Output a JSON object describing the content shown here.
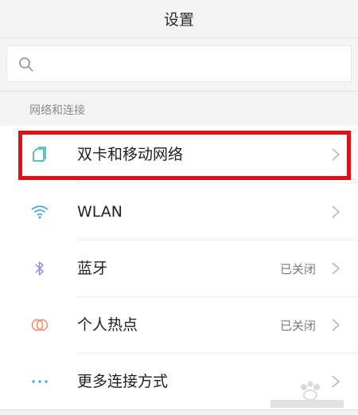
{
  "header": {
    "title": "设置"
  },
  "search": {
    "value": "",
    "placeholder": ""
  },
  "section": {
    "title": "网络和连接"
  },
  "items": [
    {
      "label": "双卡和移动网络",
      "status": "",
      "icon": "sim-cards-icon",
      "selected": true
    },
    {
      "label": "WLAN",
      "status": "",
      "icon": "wifi-icon"
    },
    {
      "label": "蓝牙",
      "status": "已关闭",
      "icon": "bluetooth-icon"
    },
    {
      "label": "个人热点",
      "status": "已关闭",
      "icon": "hotspot-icon"
    },
    {
      "label": "更多连接方式",
      "status": "",
      "icon": "more-dots-icon"
    }
  ],
  "colors": {
    "highlight": "#e50d15",
    "sim_icon": "#2bb0a7",
    "wifi_icon": "#2a9fd6",
    "bluetooth_icon": "#a77fe0",
    "hotspot_icon": "#f08a5d",
    "more_icon": "#3a9ad9"
  }
}
